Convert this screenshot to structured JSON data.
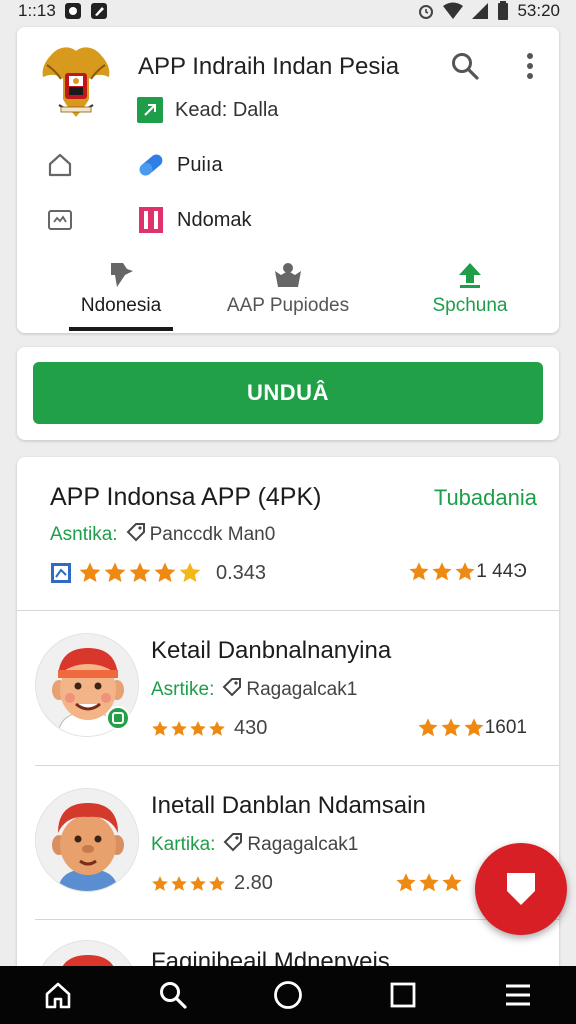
{
  "status_bar": {
    "time": "1::13",
    "clock": "53:20",
    "icons": [
      "notification-icon",
      "edit-icon",
      "alarm-icon",
      "wifi-icon",
      "signal-icon",
      "battery-icon"
    ]
  },
  "header": {
    "title": "APP Indraih Indan Pesia",
    "developer": "Kead: Dalla",
    "menu": [
      {
        "label": "Puiıa"
      },
      {
        "label": "Ndomak"
      }
    ]
  },
  "tabs": [
    {
      "label": "Ndonesia",
      "active": true
    },
    {
      "label": "AAP Pupiodes",
      "active": false
    },
    {
      "label": "Spchuna",
      "active": false
    }
  ],
  "install_button": {
    "label": "UNDUÂ"
  },
  "featured": {
    "title": "APP Indonsa APP (4PK)",
    "status": "Tubadania",
    "meta_key": "Asntika:",
    "meta_value": "Panccdk Man0",
    "rating": "0.343",
    "downloads": "1 44Ͽ",
    "stars": 5
  },
  "apps": [
    {
      "title": "Ketail Danbnalnanyina",
      "meta_key": "Asrtike:",
      "meta_value": "Ragagalcak1",
      "rating": "430",
      "downloads": "1601",
      "stars": 4
    },
    {
      "title": "Inetall Danblan Ndamsain",
      "meta_key": "Kartika:",
      "meta_value": "Ragagalcak1",
      "rating": "2.80",
      "downloads": "",
      "stars": 4
    },
    {
      "title": "Faginibeail Mdnenvęis",
      "meta_key": "",
      "meta_value": "",
      "rating": "",
      "downloads": "",
      "stars": 0
    }
  ],
  "colors": {
    "accent_green": "#21a048",
    "star": "#ee8a12",
    "fab_red": "#d81f26",
    "nav_bg": "#050505"
  },
  "nav": [
    "home-icon",
    "search-icon",
    "circle-home-icon",
    "square-recents-icon",
    "menu-icon"
  ]
}
